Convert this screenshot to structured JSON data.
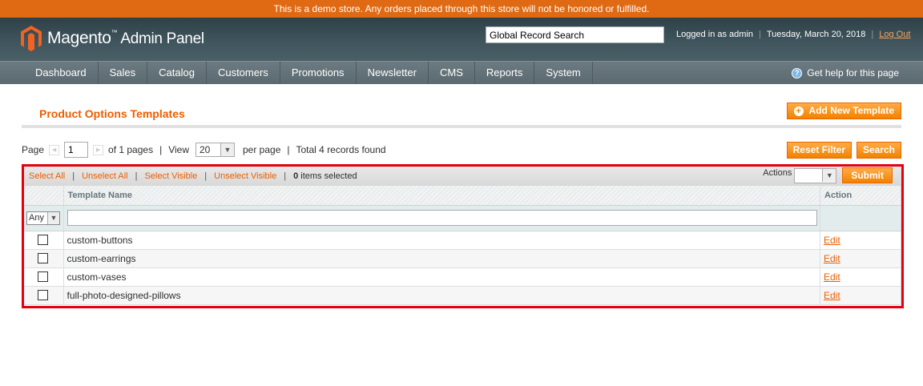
{
  "notice": "This is a demo store. Any orders placed through this store will not be honored or fulfilled.",
  "header": {
    "logo_text": "Magento",
    "logo_tm": "™",
    "logo_sub": "Admin Panel",
    "search_value": "Global Record Search",
    "logged_in": "Logged in as admin",
    "date": "Tuesday, March 20, 2018",
    "logout": "Log Out",
    "separator": "|"
  },
  "nav": {
    "items": [
      "Dashboard",
      "Sales",
      "Catalog",
      "Customers",
      "Promotions",
      "Newsletter",
      "CMS",
      "Reports",
      "System"
    ],
    "help": "Get help for this page"
  },
  "page": {
    "title": "Product Options Templates",
    "add_button": "Add New Template"
  },
  "pager": {
    "page_label": "Page",
    "page_value": "1",
    "of_pages": "of 1 pages",
    "view_label": "View",
    "view_value": "20",
    "per_page": "per page",
    "total": "Total 4 records found",
    "reset": "Reset Filter",
    "search": "Search"
  },
  "massaction": {
    "select_all": "Select All",
    "unselect_all": "Unselect All",
    "select_visible": "Select Visible",
    "unselect_visible": "Unselect Visible",
    "count": "0",
    "items_selected": "items selected",
    "actions_label": "Actions",
    "submit": "Submit"
  },
  "grid": {
    "columns": [
      "Template Name",
      "Action"
    ],
    "filter_any": "Any",
    "rows": [
      {
        "name": "custom-buttons",
        "action": "Edit"
      },
      {
        "name": "custom-earrings",
        "action": "Edit"
      },
      {
        "name": "custom-vases",
        "action": "Edit"
      },
      {
        "name": "full-photo-designed-pillows",
        "action": "Edit"
      }
    ]
  }
}
